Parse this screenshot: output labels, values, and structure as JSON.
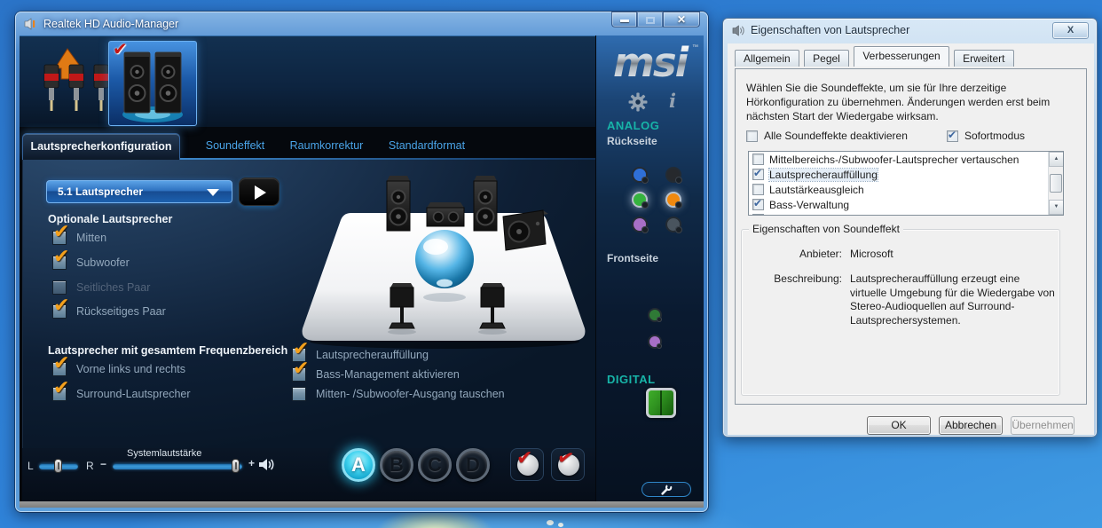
{
  "realtek": {
    "title": "Realtek HD Audio-Manager",
    "brand": "msi",
    "brand_tm": "™",
    "tabs": [
      {
        "label": "Lautsprecherkonfiguration",
        "active": true
      },
      {
        "label": "Soundeffekt",
        "active": false
      },
      {
        "label": "Raumkorrektur",
        "active": false
      },
      {
        "label": "Standardformat",
        "active": false
      }
    ],
    "speaker_config": {
      "value": "5.1 Lautsprecher"
    },
    "optional": {
      "heading": "Optionale Lautsprecher",
      "items": [
        {
          "label": "Mitten",
          "checked": true
        },
        {
          "label": "Subwoofer",
          "checked": true
        },
        {
          "label": "Seitliches Paar",
          "checked": false,
          "disabled": true
        },
        {
          "label": "Rückseitiges Paar",
          "checked": true
        }
      ]
    },
    "fullrange": {
      "heading": "Lautsprecher mit gesamtem Frequenzbereich",
      "items": [
        {
          "label": "Vorne links und rechts",
          "checked": true
        },
        {
          "label": "Surround-Lautsprecher",
          "checked": true
        }
      ]
    },
    "effects": {
      "items": [
        {
          "label": "Lautsprecherauffüllung",
          "checked": true
        },
        {
          "label": "Bass-Management aktivieren",
          "checked": true
        },
        {
          "label": "Mitten- /Subwoofer-Ausgang tauschen",
          "checked": false
        }
      ]
    },
    "bottom": {
      "balance_left": "L",
      "balance_right": "R",
      "volume_label": "Systemlautstärke",
      "minus": "−",
      "plus": "+"
    },
    "profiles": [
      {
        "label": "A",
        "active": true
      },
      {
        "label": "B",
        "active": false
      },
      {
        "label": "C",
        "active": false
      },
      {
        "label": "D",
        "active": false
      }
    ],
    "io_panel": {
      "analog": "ANALOG",
      "back_label": "Rückseite",
      "front_label": "Frontseite",
      "digital": "DIGITAL"
    },
    "colors": {
      "check_orange": "#f4a01c",
      "teal_label": "#17b4a8",
      "jack_blue": "#2f6fd6",
      "jack_black": "#23262a",
      "jack_green": "#35b33e",
      "jack_orange": "#f0890f",
      "jack_pink": "#b07ad0",
      "jack_grey": "#4a545e"
    }
  },
  "dialog": {
    "title": "Eigenschaften von Lautsprecher",
    "tabs": [
      {
        "label": "Allgemein",
        "active": false
      },
      {
        "label": "Pegel",
        "active": false
      },
      {
        "label": "Verbesserungen",
        "active": true
      },
      {
        "label": "Erweitert",
        "active": false
      }
    ],
    "intro": "Wählen Sie die Soundeffekte, um sie für Ihre derzeitige Hörkonfiguration zu übernehmen. Änderungen werden erst beim nächsten Start der Wiedergabe wirksam.",
    "disable_all": {
      "label": "Alle Soundeffekte deaktivieren",
      "checked": false
    },
    "instant": {
      "label": "Sofortmodus",
      "checked": true
    },
    "effects_list": [
      {
        "label": "Mittelbereichs-/Subwoofer-Lautsprecher vertauschen",
        "checked": false,
        "selected": false
      },
      {
        "label": "Lautsprecherauffüllung",
        "checked": true,
        "selected": true
      },
      {
        "label": "Lautstärkeausgleich",
        "checked": false,
        "selected": false
      },
      {
        "label": "Bass-Verwaltung",
        "checked": true,
        "selected": false
      }
    ],
    "group": {
      "title": "Eigenschaften von Soundeffekt",
      "provider_label": "Anbieter:",
      "provider_value": "Microsoft",
      "description_label": "Beschreibung:",
      "description_value": "Lautsprecherauffüllung erzeugt eine virtuelle Umgebung für die Wiedergabe von Stereo-Audioquellen auf Surround-Lautsprechersystemen."
    },
    "buttons": {
      "ok": "OK",
      "cancel": "Abbrechen",
      "apply": "Übernehmen"
    }
  }
}
